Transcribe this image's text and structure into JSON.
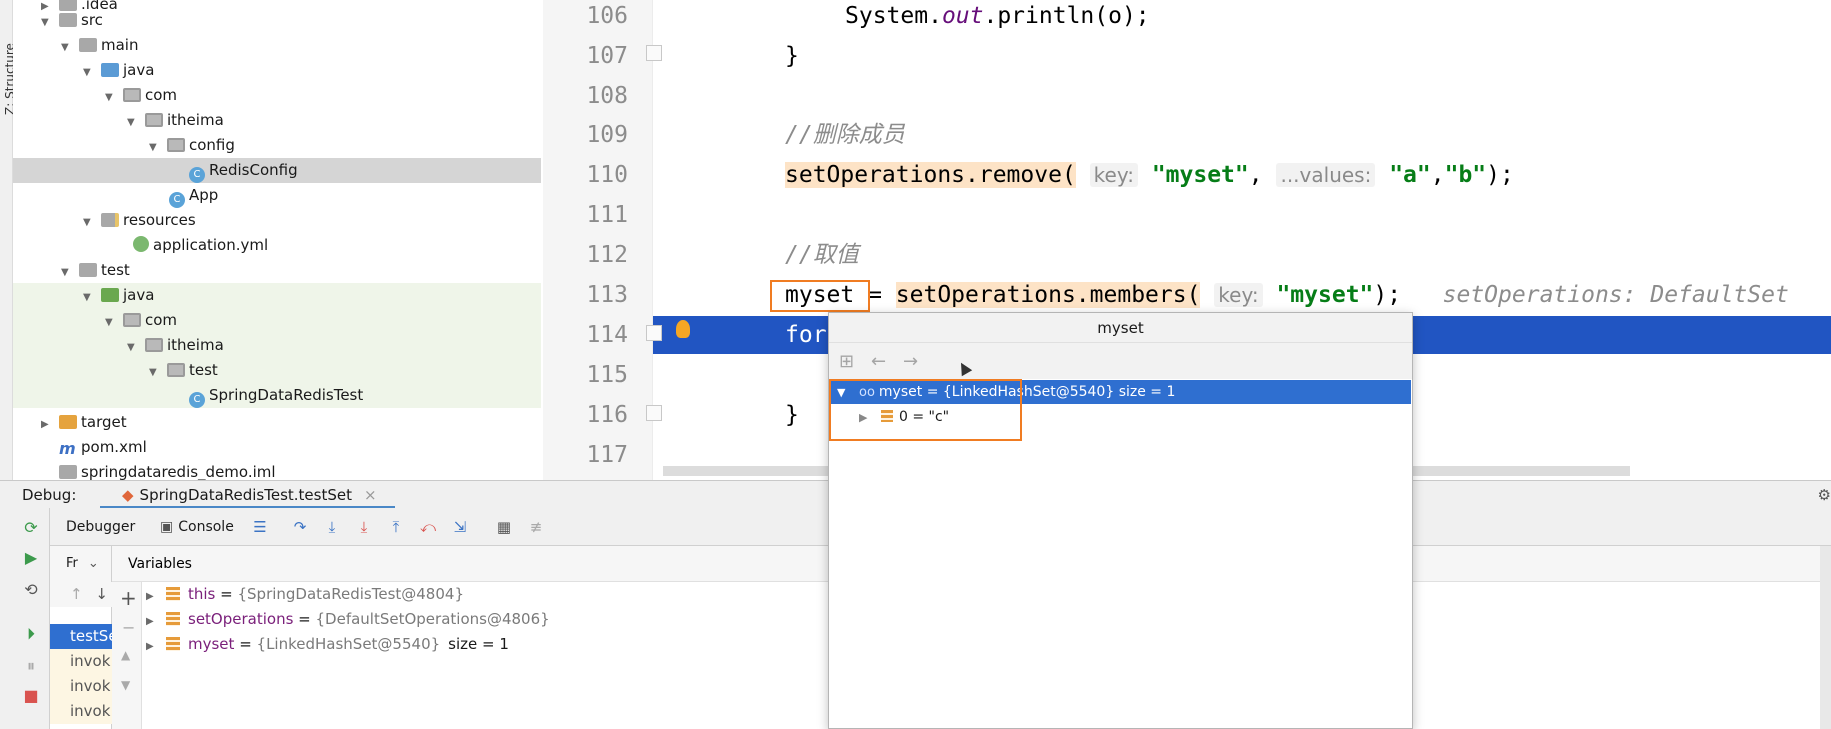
{
  "tool_strip": {
    "label": "Z: Structure"
  },
  "project_tree": {
    "items": [
      {
        "label": ".idea",
        "indent": 1,
        "icon": "folder"
      },
      {
        "label": "src",
        "indent": 1,
        "icon": "folder"
      },
      {
        "label": "main",
        "indent": 2,
        "icon": "folder"
      },
      {
        "label": "java",
        "indent": 3,
        "icon": "folder-blue"
      },
      {
        "label": "com",
        "indent": 4,
        "icon": "package"
      },
      {
        "label": "itheima",
        "indent": 5,
        "icon": "package"
      },
      {
        "label": "config",
        "indent": 6,
        "icon": "package"
      },
      {
        "label": "RedisConfig",
        "indent": 7,
        "icon": "class"
      },
      {
        "label": "App",
        "indent": 6,
        "icon": "class"
      },
      {
        "label": "resources",
        "indent": 3,
        "icon": "resources-folder"
      },
      {
        "label": "application.yml",
        "indent": 5,
        "icon": "yml"
      },
      {
        "label": "test",
        "indent": 2,
        "icon": "folder"
      },
      {
        "label": "java",
        "indent": 3,
        "icon": "folder-green"
      },
      {
        "label": "com",
        "indent": 4,
        "icon": "package"
      },
      {
        "label": "itheima",
        "indent": 5,
        "icon": "package"
      },
      {
        "label": "test",
        "indent": 6,
        "icon": "package"
      },
      {
        "label": "SpringDataRedisTest",
        "indent": 7,
        "icon": "class"
      },
      {
        "label": "target",
        "indent": 1,
        "icon": "folder-orange"
      },
      {
        "label": "pom.xml",
        "indent": 1,
        "icon": "maven"
      },
      {
        "label": "springdataredis_demo.iml",
        "indent": 1,
        "icon": "file"
      }
    ]
  },
  "editor": {
    "lines": [
      {
        "num": "106",
        "code": "System.out.println(o);"
      },
      {
        "num": "107",
        "code": "}"
      },
      {
        "num": "108",
        "code": ""
      },
      {
        "num": "109",
        "code": "//删除成员"
      },
      {
        "num": "110",
        "code": "setOperations.remove( key: \"myset\", ...values: \"a\",\"b\");"
      },
      {
        "num": "111",
        "code": ""
      },
      {
        "num": "112",
        "code": "//取值"
      },
      {
        "num": "113",
        "code": "myset = setOperations.members( key: \"myset\");   setOperations: DefaultSet"
      },
      {
        "num": "114",
        "code": "for"
      },
      {
        "num": "115",
        "code": ""
      },
      {
        "num": "116",
        "code": "}"
      },
      {
        "num": "117",
        "code": ""
      }
    ],
    "tokens": {
      "l106_a": "System.",
      "l106_b": "out",
      "l106_c": ".println(o);",
      "l107": "}",
      "l109": "//删除成员",
      "l110_a": "setOperations.remove(",
      "l110_hint1": "key:",
      "l110_str1": "\"myset\"",
      "l110_comma": ",",
      "l110_hint2": "...values:",
      "l110_str2": "\"a\"",
      "l110_str3": "\"b\"",
      "l110_end": ");",
      "l112": "//取值",
      "l113_var": "myset",
      "l113_eq": " = ",
      "l113_call": "setOperations.members(",
      "l113_hint": "key:",
      "l113_str": "\"myset\"",
      "l113_end": ");",
      "l113_inline": "setOperations: DefaultSet",
      "l114": "for",
      "l116": "}"
    }
  },
  "debug": {
    "label": "Debug:",
    "tab_label": "SpringDataRedisTest.testSet",
    "tab_close": "×",
    "tabs": {
      "debugger": "Debugger",
      "console": "Console"
    },
    "frames_header": "Fr",
    "frames": [
      "testSe",
      "invok",
      "invok",
      "invok"
    ],
    "vars_header": "Variables",
    "variables": [
      {
        "name": "this",
        "eq": " = ",
        "value": "{SpringDataRedisTest@4804}",
        "size": ""
      },
      {
        "name": "setOperations",
        "eq": " = ",
        "value": "{DefaultSetOperations@4806}",
        "size": ""
      },
      {
        "name": "myset",
        "eq": " = ",
        "value": "{LinkedHashSet@5540}",
        "size": "size = 1"
      }
    ]
  },
  "popup": {
    "title": "myset",
    "root_row": "myset = {LinkedHashSet@5540}  size = 1",
    "child_row": "0 = \"c\""
  },
  "colors": {
    "execution_line": "#2155c2",
    "highlight_box": "#f07c22",
    "selection": "#2f6fd0"
  }
}
